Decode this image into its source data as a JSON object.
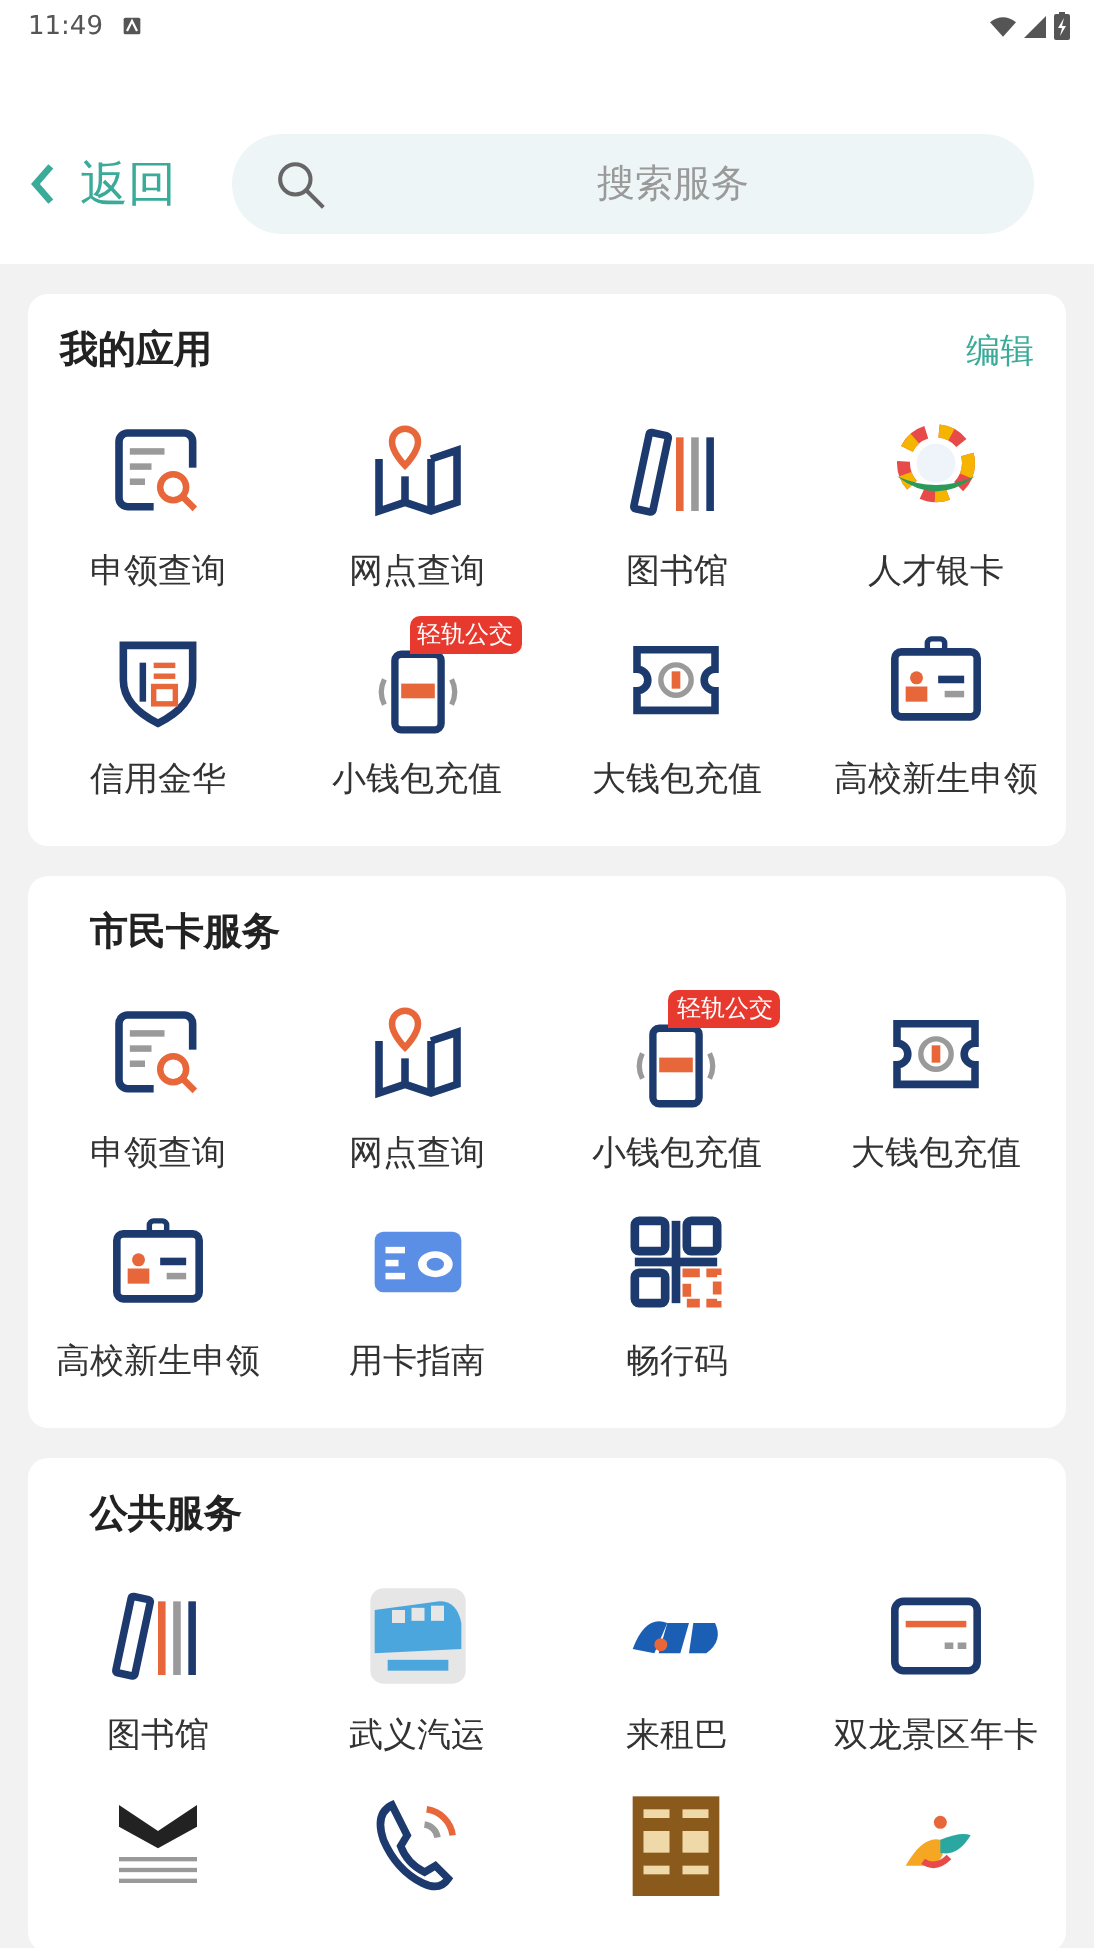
{
  "status_bar": {
    "time": "11:49"
  },
  "header": {
    "back": "返回",
    "search": {
      "placeholder": "搜索服务"
    }
  },
  "sections": [
    {
      "title": "我的应用",
      "action": "编辑",
      "items": [
        {
          "label": "申领查询",
          "kind": "apply-query"
        },
        {
          "label": "网点查询",
          "kind": "outlet-map"
        },
        {
          "label": "图书馆",
          "kind": "library"
        },
        {
          "label": "人才银卡",
          "kind": "talent-card"
        },
        {
          "label": "信用金华",
          "kind": "credit"
        },
        {
          "label": "小钱包充值",
          "kind": "nfc",
          "badge": "轻轨公交"
        },
        {
          "label": "大钱包充值",
          "kind": "wallet"
        },
        {
          "label": "高校新生申领",
          "kind": "student-id"
        }
      ]
    },
    {
      "title": "市民卡服务",
      "items": [
        {
          "label": "申领查询",
          "kind": "apply-query"
        },
        {
          "label": "网点查询",
          "kind": "outlet-map"
        },
        {
          "label": "小钱包充值",
          "kind": "nfc",
          "badge": "轻轨公交"
        },
        {
          "label": "大钱包充值",
          "kind": "wallet"
        },
        {
          "label": "高校新生申领",
          "kind": "student-id"
        },
        {
          "label": "用卡指南",
          "kind": "card-guide"
        },
        {
          "label": "畅行码",
          "kind": "qr"
        }
      ]
    },
    {
      "title": "公共服务",
      "items": [
        {
          "label": "图书馆",
          "kind": "library"
        },
        {
          "label": "武义汽运",
          "kind": "bus"
        },
        {
          "label": "来租巴",
          "kind": "rental"
        },
        {
          "label": "双龙景区年卡",
          "kind": "scenic-card"
        },
        {
          "kind": "museum-m"
        },
        {
          "kind": "hotline"
        },
        {
          "kind": "museum-gold"
        },
        {
          "kind": "tour"
        }
      ]
    }
  ]
}
